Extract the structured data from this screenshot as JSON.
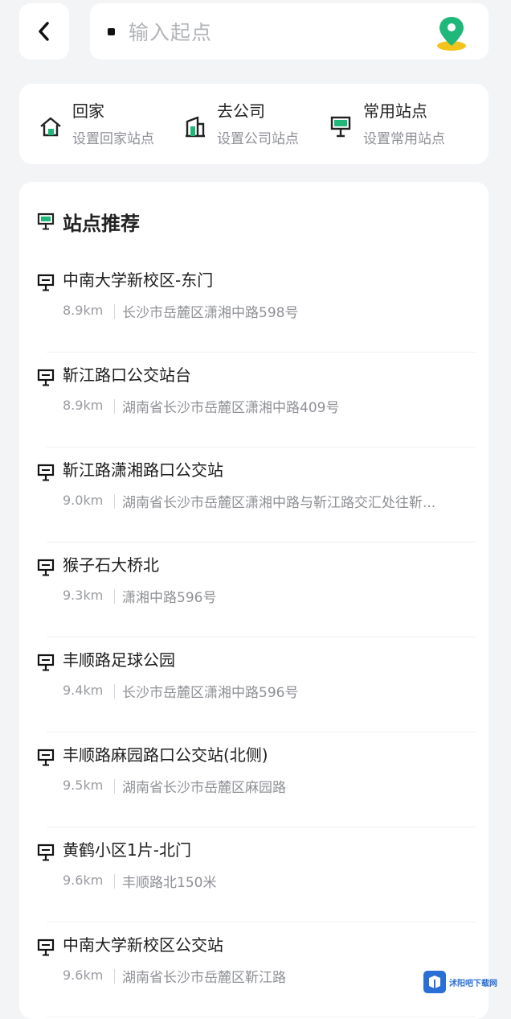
{
  "search": {
    "placeholder": "输入起点"
  },
  "icons": {
    "back": "chevron-left-icon",
    "map": "map-pin-icon",
    "home": "home-icon",
    "company": "office-icon",
    "stop": "bus-stop-icon"
  },
  "colors": {
    "accent": "#1fb87a",
    "background": "#f3f4f6"
  },
  "quick": [
    {
      "title": "回家",
      "subtitle": "设置回家站点"
    },
    {
      "title": "去公司",
      "subtitle": "设置公司站点"
    },
    {
      "title": "常用站点",
      "subtitle": "设置常用站点"
    }
  ],
  "section": {
    "title": "站点推荐"
  },
  "stations": [
    {
      "name": "中南大学新校区-东门",
      "distance": "8.9km",
      "address": "长沙市岳麓区潇湘中路598号"
    },
    {
      "name": "靳江路口公交站台",
      "distance": "8.9km",
      "address": "湖南省长沙市岳麓区潇湘中路409号"
    },
    {
      "name": "靳江路潇湘路口公交站",
      "distance": "9.0km",
      "address": "湖南省长沙市岳麓区潇湘中路与靳江路交汇处往靳..."
    },
    {
      "name": "猴子石大桥北",
      "distance": "9.3km",
      "address": "潇湘中路596号"
    },
    {
      "name": "丰顺路足球公园",
      "distance": "9.4km",
      "address": "长沙市岳麓区潇湘中路596号"
    },
    {
      "name": "丰顺路麻园路口公交站(北侧)",
      "distance": "9.5km",
      "address": "湖南省长沙市岳麓区麻园路"
    },
    {
      "name": "黄鹤小区1片-北门",
      "distance": "9.6km",
      "address": "丰顺路北150米"
    },
    {
      "name": "中南大学新校区公交站",
      "distance": "9.6km",
      "address": "湖南省长沙市岳麓区靳江路"
    }
  ],
  "watermark": {
    "text": "沭阳吧下载网"
  }
}
